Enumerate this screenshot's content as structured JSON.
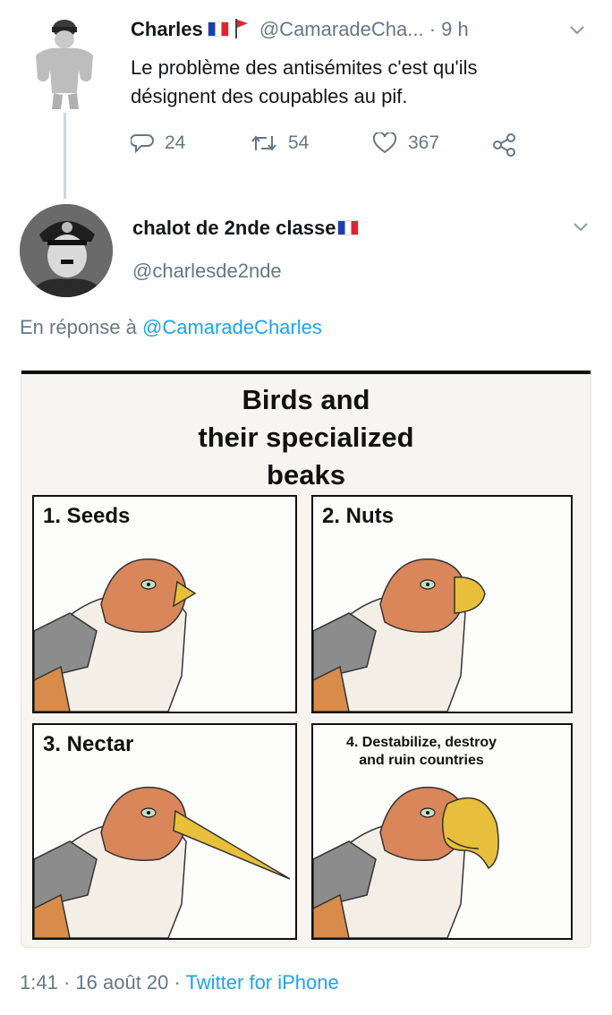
{
  "tweet1": {
    "display_name": "Charles",
    "handle": "@CamaradeCha...",
    "time": "9 h",
    "text_line1": "Le problème des antisémites c'est qu'ils",
    "text_line2": "désignent des coupables au pif.",
    "replies": "24",
    "retweets": "54",
    "likes": "367"
  },
  "tweet2": {
    "display_name": "chalot de 2nde classe",
    "handle": "@charlesde2nde",
    "reply_prefix": "En réponse à",
    "reply_to": "@CamaradeCharles",
    "meme": {
      "title_line1": "Birds and",
      "title_line2": "their specialized",
      "title_line3": "beaks",
      "panels": [
        {
          "label": "1. Seeds"
        },
        {
          "label": "2. Nuts"
        },
        {
          "label": "3. Nectar"
        },
        {
          "label_line1": "4. Destabilize, destroy",
          "label_line2": "and ruin countries"
        }
      ]
    },
    "time": "1:41",
    "date": "16 août 20",
    "source": "Twitter for iPhone"
  },
  "colors": {
    "link": "#1da1f2",
    "muted": "#657786",
    "flag_blue": "#1d3fae",
    "flag_red": "#e0242f"
  },
  "icons": [
    "muscular-figure-avatar",
    "chaplin-avatar",
    "reply-icon",
    "retweet-icon",
    "like-icon",
    "share-icon",
    "chevron-down-icon",
    "french-flag-icon",
    "red-flag-icon"
  ]
}
